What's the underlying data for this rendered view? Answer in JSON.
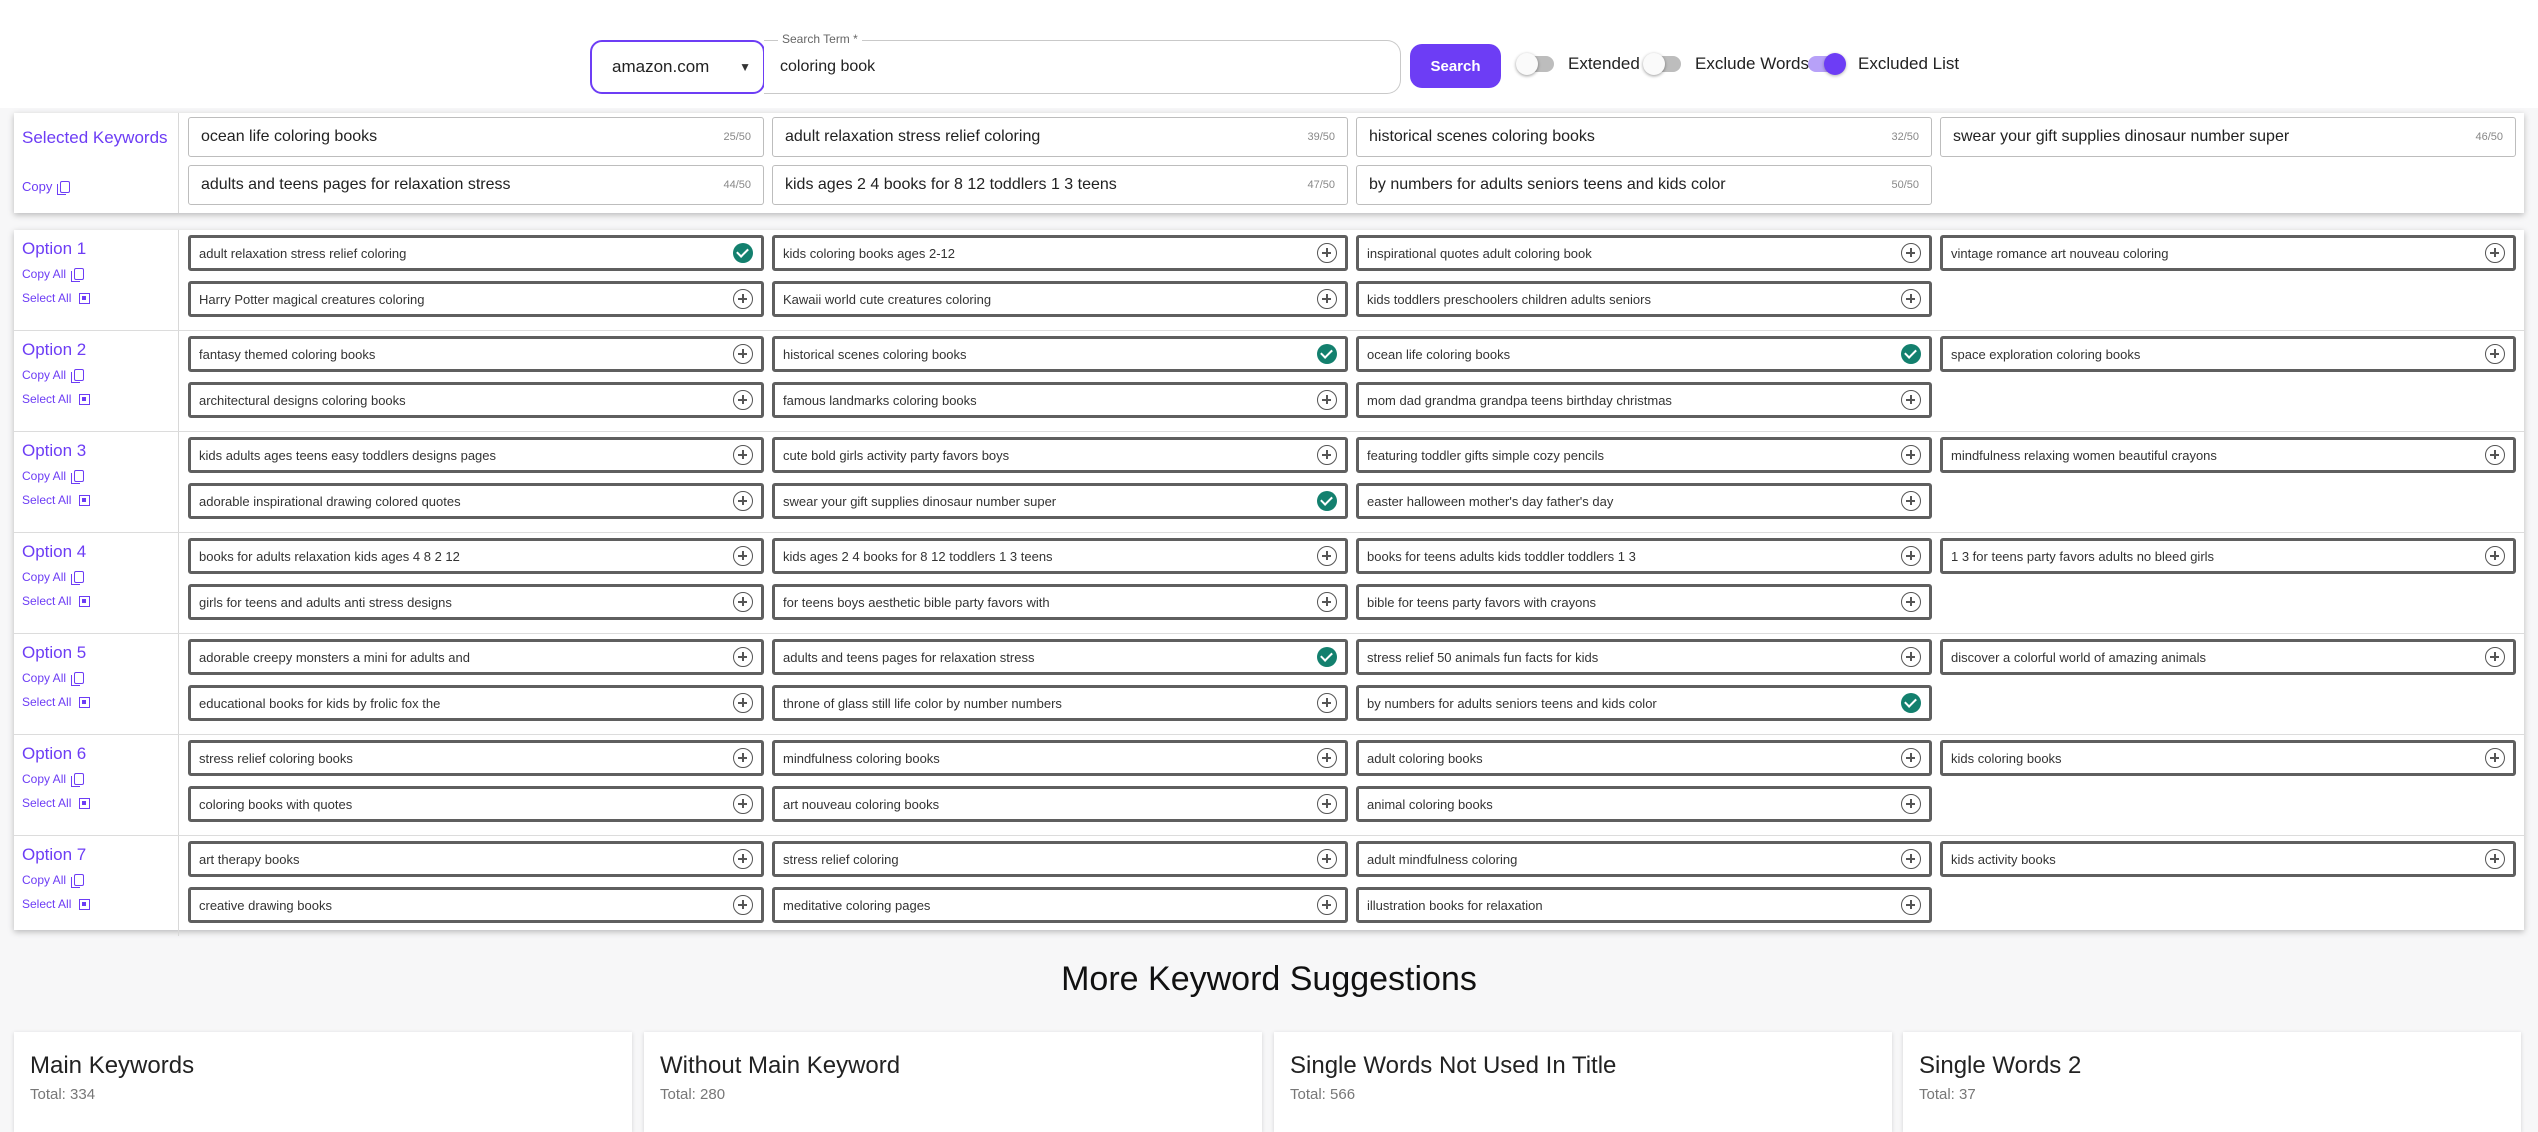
{
  "search": {
    "site": "amazon.com",
    "label": "Search Term *",
    "term": "coloring book",
    "button": "Search"
  },
  "toggles": [
    {
      "label": "Extended",
      "on": false
    },
    {
      "label": "Exclude Words",
      "on": false
    },
    {
      "label": "Excluded List",
      "on": true
    }
  ],
  "selected": {
    "title": "Selected Keywords",
    "copy": "Copy",
    "items": [
      {
        "text": "ocean life coloring books",
        "count": "25/50"
      },
      {
        "text": "adult relaxation stress relief coloring",
        "count": "39/50"
      },
      {
        "text": "historical scenes coloring books",
        "count": "32/50"
      },
      {
        "text": "swear your gift supplies dinosaur number super",
        "count": "46/50"
      },
      {
        "text": "adults and teens pages for relaxation stress",
        "count": "44/50"
      },
      {
        "text": "kids ages 2 4 books for 8 12 toddlers 1 3 teens",
        "count": "47/50"
      },
      {
        "text": "by numbers for adults seniors teens and kids color",
        "count": "50/50"
      }
    ]
  },
  "options": [
    {
      "title": "Option 1",
      "copy_all": "Copy All",
      "select_all": "Select All",
      "items": [
        {
          "text": "adult relaxation stress relief coloring",
          "checked": true
        },
        {
          "text": "kids coloring books ages 2-12",
          "checked": false
        },
        {
          "text": "inspirational quotes adult coloring book",
          "checked": false
        },
        {
          "text": "vintage romance art nouveau coloring",
          "checked": false
        },
        {
          "text": "Harry Potter magical creatures coloring",
          "checked": false
        },
        {
          "text": "Kawaii world cute creatures coloring",
          "checked": false
        },
        {
          "text": "kids toddlers preschoolers children adults seniors",
          "checked": false
        }
      ]
    },
    {
      "title": "Option 2",
      "copy_all": "Copy All",
      "select_all": "Select All",
      "items": [
        {
          "text": "fantasy themed coloring books",
          "checked": false
        },
        {
          "text": "historical scenes coloring books",
          "checked": true
        },
        {
          "text": "ocean life coloring books",
          "checked": true
        },
        {
          "text": "space exploration coloring books",
          "checked": false
        },
        {
          "text": "architectural designs coloring books",
          "checked": false
        },
        {
          "text": "famous landmarks coloring books",
          "checked": false
        },
        {
          "text": "mom dad grandma grandpa teens birthday christmas",
          "checked": false
        }
      ]
    },
    {
      "title": "Option 3",
      "copy_all": "Copy All",
      "select_all": "Select All",
      "items": [
        {
          "text": "kids adults ages teens easy toddlers designs pages",
          "checked": false
        },
        {
          "text": "cute bold girls activity party favors boys",
          "checked": false
        },
        {
          "text": "featuring toddler gifts simple cozy pencils",
          "checked": false
        },
        {
          "text": "mindfulness relaxing women beautiful crayons",
          "checked": false
        },
        {
          "text": "adorable inspirational drawing colored quotes",
          "checked": false
        },
        {
          "text": "swear your gift supplies dinosaur number super",
          "checked": true
        },
        {
          "text": "easter halloween mother's day father's day",
          "checked": false
        }
      ]
    },
    {
      "title": "Option 4",
      "copy_all": "Copy All",
      "select_all": "Select All",
      "items": [
        {
          "text": "books for adults relaxation kids ages 4 8 2 12",
          "checked": false
        },
        {
          "text": "kids ages 2 4 books for 8 12 toddlers 1 3 teens",
          "checked": false
        },
        {
          "text": "books for teens adults kids toddler toddlers 1 3",
          "checked": false
        },
        {
          "text": "1 3 for teens party favors adults no bleed girls",
          "checked": false
        },
        {
          "text": "girls for teens and adults anti stress designs",
          "checked": false
        },
        {
          "text": "for teens boys aesthetic bible party favors with",
          "checked": false
        },
        {
          "text": "bible for teens party favors with crayons",
          "checked": false
        }
      ]
    },
    {
      "title": "Option 5",
      "copy_all": "Copy All",
      "select_all": "Select All",
      "items": [
        {
          "text": "adorable creepy monsters a mini for adults and",
          "checked": false
        },
        {
          "text": "adults and teens pages for relaxation stress",
          "checked": true
        },
        {
          "text": "stress relief 50 animals fun facts for kids",
          "checked": false
        },
        {
          "text": "discover a colorful world of amazing animals",
          "checked": false
        },
        {
          "text": "educational books for kids by frolic fox the",
          "checked": false
        },
        {
          "text": "throne of glass still life color by number numbers",
          "checked": false
        },
        {
          "text": "by numbers for adults seniors teens and kids color",
          "checked": true
        }
      ]
    },
    {
      "title": "Option 6",
      "copy_all": "Copy All",
      "select_all": "Select All",
      "items": [
        {
          "text": "stress relief coloring books",
          "checked": false
        },
        {
          "text": "mindfulness coloring books",
          "checked": false
        },
        {
          "text": "adult coloring books",
          "checked": false
        },
        {
          "text": "kids coloring books",
          "checked": false
        },
        {
          "text": "coloring books with quotes",
          "checked": false
        },
        {
          "text": "art nouveau coloring books",
          "checked": false
        },
        {
          "text": "animal coloring books",
          "checked": false
        }
      ]
    },
    {
      "title": "Option 7",
      "copy_all": "Copy All",
      "select_all": "Select All",
      "items": [
        {
          "text": "art therapy books",
          "checked": false
        },
        {
          "text": "stress relief coloring",
          "checked": false
        },
        {
          "text": "adult mindfulness coloring",
          "checked": false
        },
        {
          "text": "kids activity books",
          "checked": false
        },
        {
          "text": "creative drawing books",
          "checked": false
        },
        {
          "text": "meditative coloring pages",
          "checked": false
        },
        {
          "text": "illustration books for relaxation",
          "checked": false
        }
      ]
    }
  ],
  "more": {
    "title": "More Keyword Suggestions",
    "cards": [
      {
        "title": "Main Keywords",
        "total": "Total: 334"
      },
      {
        "title": "Without Main Keyword",
        "total": "Total: 280"
      },
      {
        "title": "Single Words Not Used In Title",
        "total": "Total: 566"
      },
      {
        "title": "Single Words 2",
        "total": "Total: 37"
      }
    ]
  }
}
